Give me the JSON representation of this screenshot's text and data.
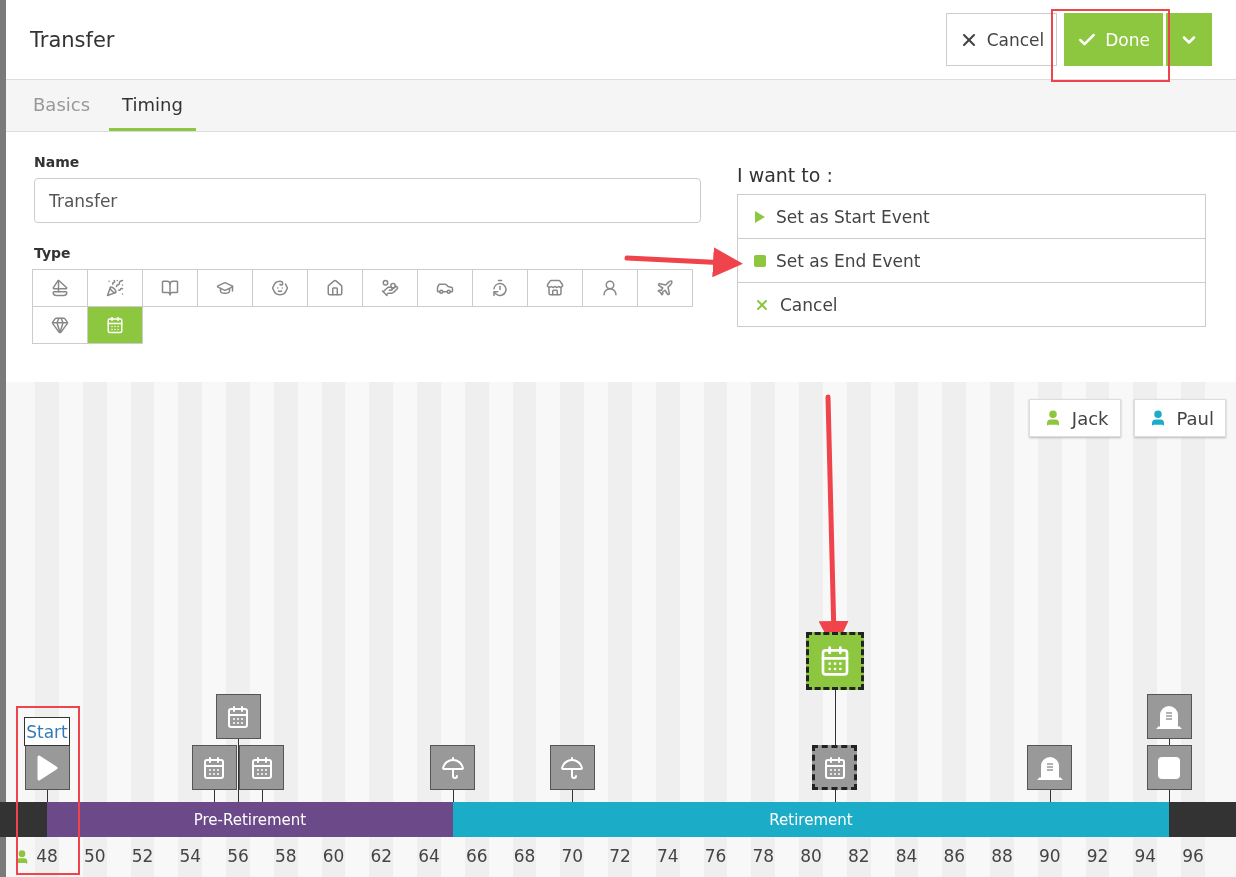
{
  "window": {
    "title": "Transfer"
  },
  "header_buttons": [
    {
      "kind": "cancel",
      "label": "Cancel"
    },
    {
      "kind": "done",
      "label": "Done"
    },
    {
      "kind": "menu"
    }
  ],
  "tabs": [
    {
      "label": "Basics",
      "selected": false
    },
    {
      "label": "Timing",
      "selected": true
    }
  ],
  "name_field": {
    "label": "Name",
    "value": "Transfer"
  },
  "type_picker": {
    "label": "Type",
    "types": [
      {
        "kind": "sailboat",
        "selected": false
      },
      {
        "kind": "party",
        "selected": false
      },
      {
        "kind": "book",
        "selected": false
      },
      {
        "kind": "graduation",
        "selected": false
      },
      {
        "kind": "toy",
        "selected": false
      },
      {
        "kind": "house",
        "selected": false
      },
      {
        "kind": "money",
        "selected": false
      },
      {
        "kind": "car",
        "selected": false
      },
      {
        "kind": "timer",
        "selected": false
      },
      {
        "kind": "store",
        "selected": false
      },
      {
        "kind": "person",
        "selected": false
      },
      {
        "kind": "plane",
        "selected": false
      },
      {
        "kind": "rings",
        "selected": false
      },
      {
        "kind": "calendar",
        "selected": true
      }
    ]
  },
  "actions": {
    "title": "I want to :",
    "options": [
      {
        "kind": "start",
        "label": "Set as Start Event"
      },
      {
        "kind": "end",
        "label": "Set as End Event"
      },
      {
        "kind": "cancel",
        "label": "Cancel"
      }
    ]
  },
  "people": [
    {
      "name": "Jack",
      "color": "#8dc63f"
    },
    {
      "name": "Paul",
      "color": "#1badc8"
    }
  ],
  "timeline": {
    "phases": [
      {
        "label": "Pre-Retirement",
        "color": "#6c4a8a",
        "years": [
          {
            "kind": "shaded",
            "tick": "48",
            "events": [
              {
                "kind": "play",
                "label": "Start",
                "selected": false,
                "active": false
              }
            ]
          },
          {
            "kind": "light"
          },
          {
            "kind": "shaded",
            "tick": "50"
          },
          {
            "kind": "light"
          },
          {
            "kind": "shaded",
            "tick": "52"
          },
          {
            "kind": "light"
          },
          {
            "kind": "shaded",
            "tick": "54"
          },
          {
            "kind": "light",
            "events": [
              {
                "kind": "calendar",
                "selected": false,
                "active": false
              }
            ]
          },
          {
            "kind": "shaded",
            "tick": "56",
            "raised_events": [
              {
                "kind": "calendar",
                "selected": false,
                "active": false
              }
            ]
          },
          {
            "kind": "light",
            "events": [
              {
                "kind": "calendar",
                "selected": false,
                "active": false
              }
            ]
          },
          {
            "kind": "shaded",
            "tick": "58"
          },
          {
            "kind": "light"
          },
          {
            "kind": "shaded",
            "tick": "60"
          },
          {
            "kind": "light"
          },
          {
            "kind": "shaded",
            "tick": "62"
          },
          {
            "kind": "light"
          },
          {
            "kind": "shaded",
            "tick": "64"
          }
        ]
      },
      {
        "label": "Retirement",
        "color": "#1badc8",
        "years": [
          {
            "kind": "light",
            "events": [
              {
                "kind": "umbrella",
                "selected": false,
                "active": false
              }
            ]
          },
          {
            "kind": "shaded",
            "tick": "66"
          },
          {
            "kind": "light"
          },
          {
            "kind": "shaded",
            "tick": "68"
          },
          {
            "kind": "light"
          },
          {
            "kind": "shaded",
            "tick": "70",
            "events": [
              {
                "kind": "umbrella",
                "selected": false,
                "active": false
              }
            ]
          },
          {
            "kind": "light"
          },
          {
            "kind": "shaded",
            "tick": "72"
          },
          {
            "kind": "light"
          },
          {
            "kind": "shaded",
            "tick": "74"
          },
          {
            "kind": "light"
          },
          {
            "kind": "shaded",
            "tick": "76"
          },
          {
            "kind": "light"
          },
          {
            "kind": "shaded",
            "tick": "78"
          },
          {
            "kind": "light"
          },
          {
            "kind": "shaded",
            "tick": "80"
          },
          {
            "kind": "light",
            "events": [
              {
                "kind": "calendar",
                "selected": true,
                "active": false
              }
            ],
            "raised_events": [
              {
                "kind": "calendar",
                "selected": true,
                "active": true
              }
            ]
          },
          {
            "kind": "shaded",
            "tick": "82"
          },
          {
            "kind": "light"
          },
          {
            "kind": "shaded",
            "tick": "84"
          },
          {
            "kind": "light"
          },
          {
            "kind": "shaded",
            "tick": "86"
          },
          {
            "kind": "light"
          },
          {
            "kind": "shaded",
            "tick": "88"
          },
          {
            "kind": "light"
          },
          {
            "kind": "shaded",
            "tick": "90",
            "events": [
              {
                "kind": "tombstone",
                "selected": false,
                "active": false
              }
            ]
          },
          {
            "kind": "light"
          },
          {
            "kind": "shaded",
            "tick": "92"
          },
          {
            "kind": "light"
          },
          {
            "kind": "shaded",
            "tick": "94"
          }
        ]
      }
    ],
    "after": [
      {
        "kind": "light",
        "events": [
          {
            "kind": "stop",
            "selected": false,
            "active": false
          }
        ],
        "raised_events": [
          {
            "kind": "tombstone",
            "selected": false,
            "active": false
          }
        ]
      },
      {
        "kind": "shaded",
        "tick": "96"
      }
    ]
  }
}
